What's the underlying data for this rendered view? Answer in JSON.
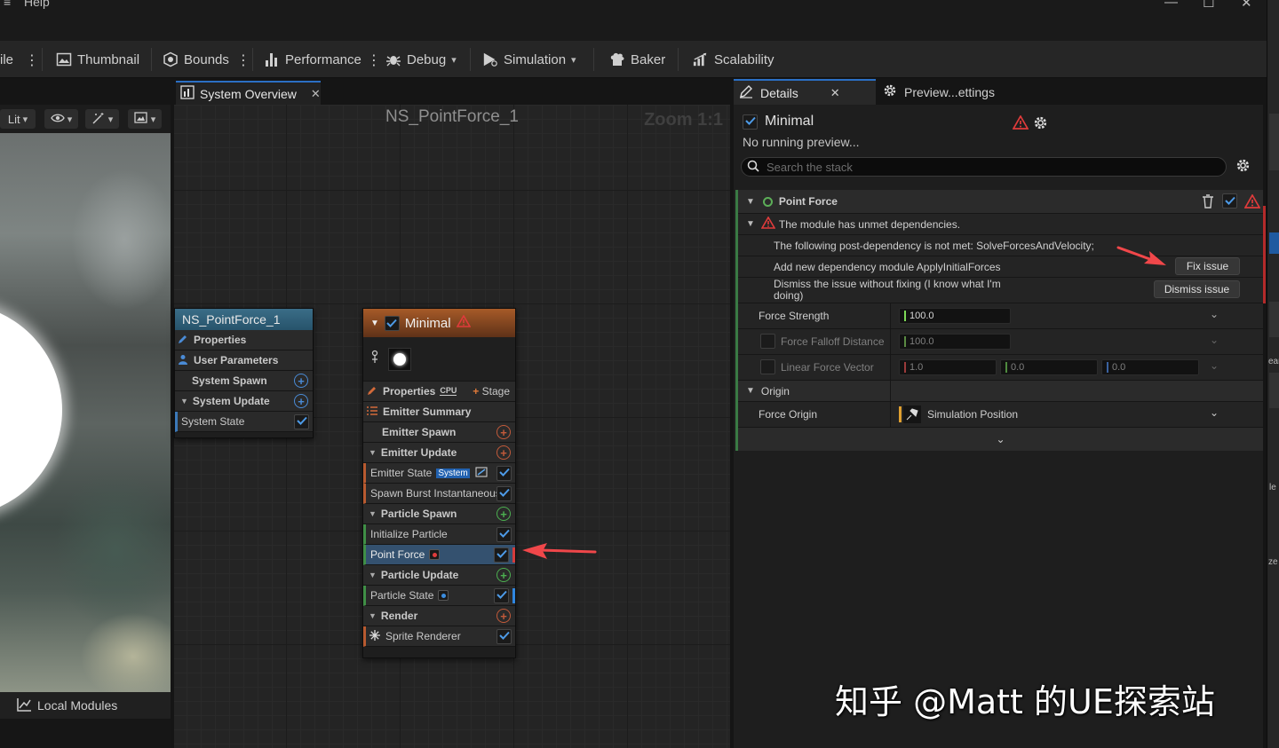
{
  "menu": {
    "help": "Help"
  },
  "toolbar": {
    "file_fragment": "ile",
    "thumbnail": "Thumbnail",
    "bounds": "Bounds",
    "performance": "Performance",
    "debug": "Debug",
    "simulation": "Simulation",
    "baker": "Baker",
    "scalability": "Scalability"
  },
  "viewport": {
    "lit_label": "Lit",
    "local_modules": "Local Modules"
  },
  "system_overview": {
    "tab_label": "System Overview",
    "graph_title": "NS_PointForce_1",
    "zoom": "Zoom 1:1",
    "system_node": {
      "title": "NS_PointForce_1",
      "rows": [
        "Properties",
        "User Parameters",
        "System Spawn",
        "System Update",
        "System State"
      ]
    },
    "emitter_node": {
      "title": "Minimal",
      "properties": "Properties",
      "cpu_badge": "CPU",
      "stage_button": "Stage",
      "emitter_summary": "Emitter Summary",
      "emitter_spawn": "Emitter Spawn",
      "emitter_update": "Emitter Update",
      "emitter_state": "Emitter State",
      "system_badge": "System",
      "spawn_burst": "Spawn Burst Instantaneous",
      "particle_spawn": "Particle Spawn",
      "initialize_particle": "Initialize Particle",
      "point_force": "Point Force",
      "particle_update": "Particle Update",
      "particle_state": "Particle State",
      "render": "Render",
      "sprite_renderer": "Sprite Renderer"
    }
  },
  "details": {
    "tab_label": "Details",
    "preview_tab_label": "Preview...ettings",
    "emitter_name": "Minimal",
    "status": "No running preview...",
    "search_placeholder": "Search the stack",
    "module_name": "Point Force",
    "issue_title": "The module has unmet dependencies.",
    "issue_line1": "The following post-dependency is not met: SolveForcesAndVelocity;",
    "issue_line2": "Add new dependency module ApplyInitialForces",
    "issue_line3": "Dismiss the issue without fixing (I know what I'm doing)",
    "fix_button": "Fix issue",
    "dismiss_button": "Dismiss issue",
    "force_strength_label": "Force Strength",
    "force_strength_value": "100.0",
    "falloff_label": "Force Falloff Distance",
    "falloff_value": "100.0",
    "linear_label": "Linear Force Vector",
    "linear_x": "1.0",
    "linear_y": "0.0",
    "linear_z": "0.0",
    "origin_label": "Origin",
    "force_origin_label": "Force Origin",
    "force_origin_value": "Simulation Position"
  },
  "edge_fragments": {
    "a": "ear",
    "b": "le",
    "c": "ze"
  },
  "watermark": "知乎 @Matt 的UE探索站",
  "colors": {
    "accent_blue": "#2b6fc4",
    "warning_red": "#e03b3b",
    "emitter_orange": "#a65a28",
    "module_green": "#3a7a44"
  }
}
